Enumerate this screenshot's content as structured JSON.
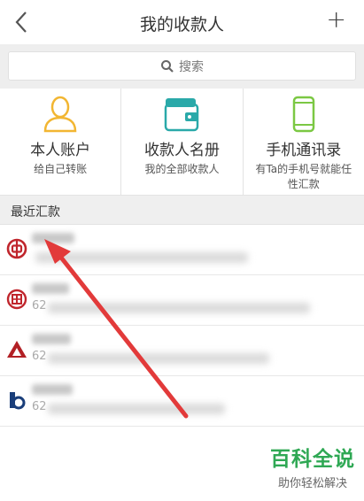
{
  "header": {
    "title": "我的收款人",
    "add_label": "+"
  },
  "search": {
    "placeholder": "搜索"
  },
  "shortcuts": [
    {
      "title": "本人账户",
      "subtitle": "给自己转账",
      "icon": "person-icon",
      "color": "#f2b632"
    },
    {
      "title": "收款人名册",
      "subtitle": "我的全部收款人",
      "icon": "wallet-icon",
      "color": "#2aa9a9"
    },
    {
      "title": "手机通讯录",
      "subtitle": "有Ta的手机号就能任性汇款",
      "icon": "phone-icon",
      "color": "#7bc843"
    }
  ],
  "recent": {
    "heading": "最近汇款",
    "items": [
      {
        "bank_icon": "bank-of-china-icon",
        "account_prefix": ""
      },
      {
        "bank_icon": "icbc-icon",
        "account_prefix": "62"
      },
      {
        "bank_icon": "ccb-icon",
        "account_prefix": "62"
      },
      {
        "bank_icon": "bocom-icon",
        "account_prefix": "62"
      }
    ]
  },
  "watermark": {
    "title": "百科全说",
    "subtitle": "助你轻松解决"
  },
  "colors": {
    "accent_red": "#e23a3a",
    "brand_green": "#2fa854"
  }
}
